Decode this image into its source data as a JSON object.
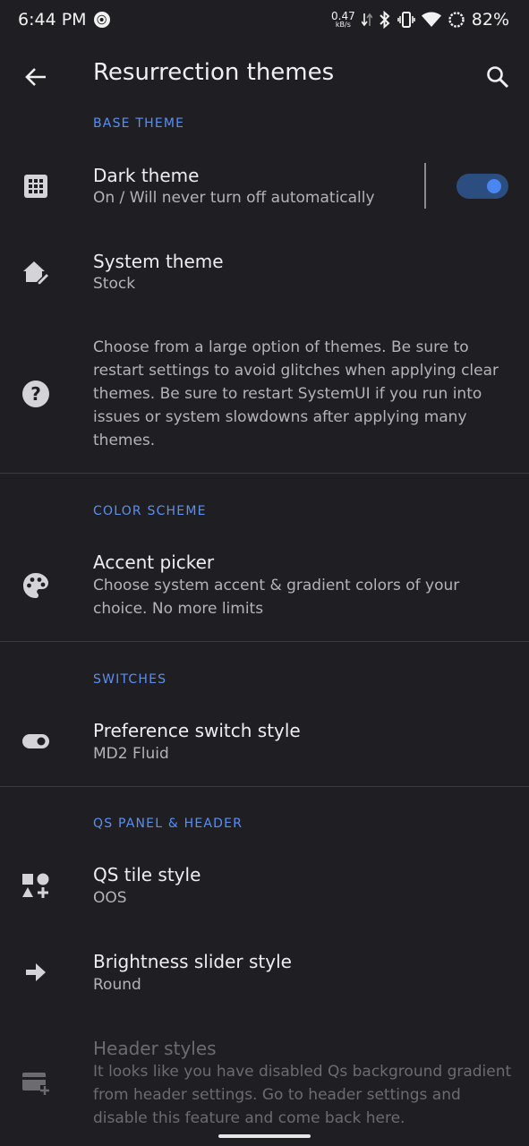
{
  "status_bar": {
    "time": "6:44 PM",
    "speed_value": "0.47",
    "speed_unit": "kB/s",
    "battery": "82%"
  },
  "app_bar": {
    "title": "Resurrection themes"
  },
  "sections": {
    "base_theme": "BASE THEME",
    "color_scheme": "COLOR SCHEME",
    "switches": "SWITCHES",
    "qs_panel": "QS PANEL & HEADER"
  },
  "items": {
    "dark_theme": {
      "title": "Dark theme",
      "summary": "On / Will never turn off automatically",
      "enabled": true
    },
    "system_theme": {
      "title": "System theme",
      "summary": "Stock"
    },
    "info_text": "Choose from a large option of themes. Be sure to restart settings to avoid glitches when applying clear themes. Be sure to restart SystemUI if you run into issues or system slowdowns after applying many themes.",
    "accent_picker": {
      "title": "Accent picker",
      "summary": "Choose system accent & gradient colors of your choice. No more limits"
    },
    "preference_switch": {
      "title": "Preference switch style",
      "summary": "MD2 Fluid"
    },
    "qs_tile_style": {
      "title": "QS tile style",
      "summary": "OOS"
    },
    "brightness_slider": {
      "title": "Brightness slider style",
      "summary": "Round"
    },
    "header_styles": {
      "title": "Header styles",
      "summary": "It looks like you have disabled Qs background gradient from header settings. Go to header settings and disable this feature and come back here."
    }
  },
  "colors": {
    "background": "#1f1f23",
    "accent": "#5b8ff0",
    "toggle_track": "#2c4d80",
    "toggle_knob": "#4a86f0"
  }
}
